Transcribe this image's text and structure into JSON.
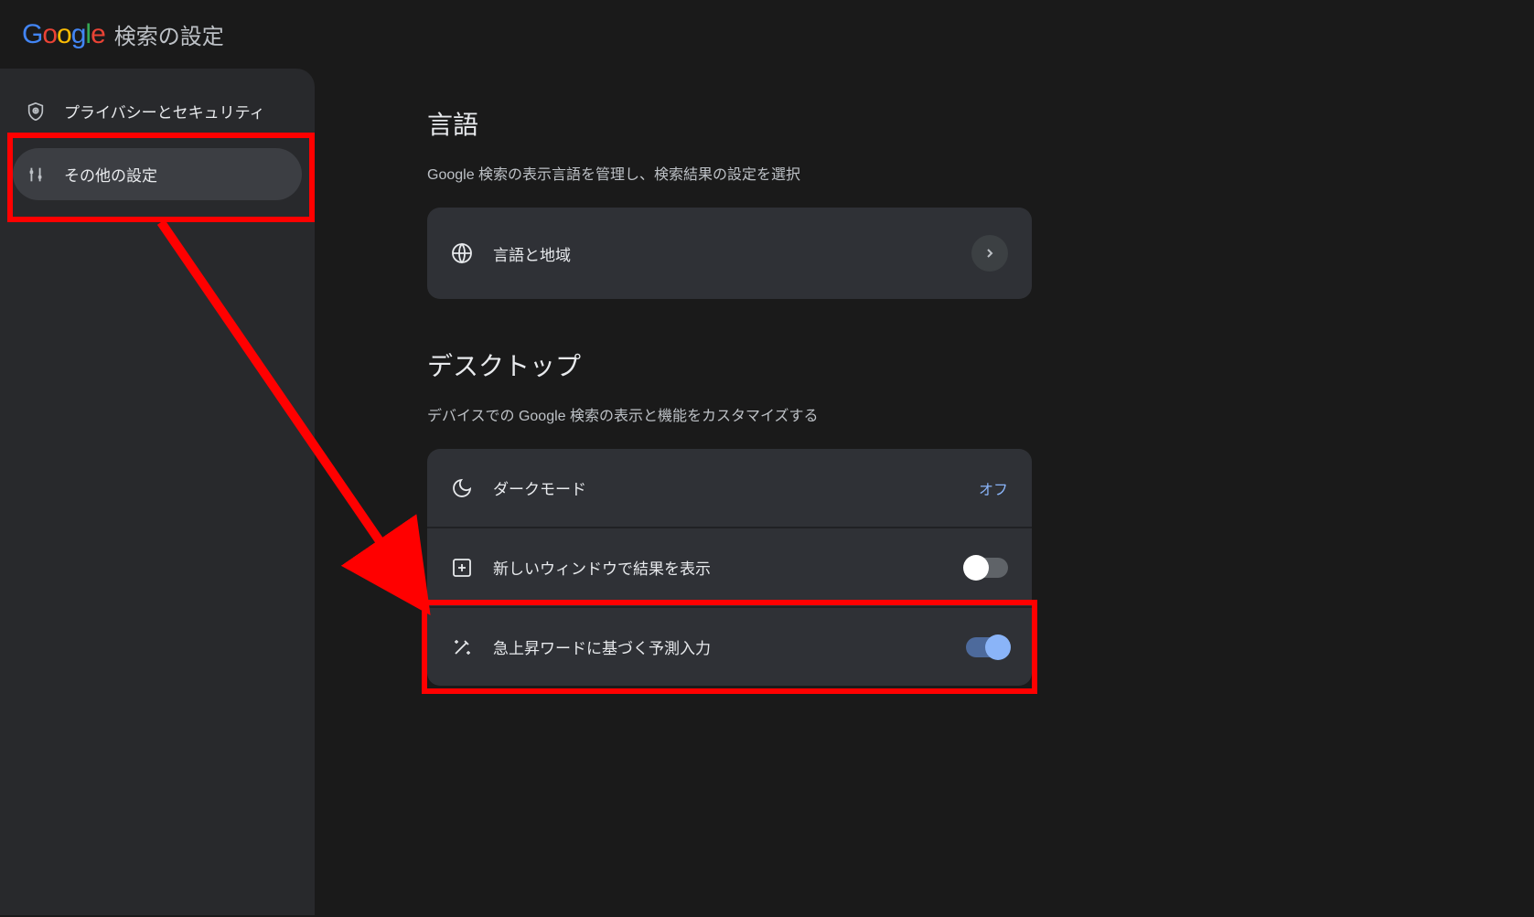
{
  "header": {
    "title": "検索の設定"
  },
  "sidebar": {
    "items": [
      {
        "label": "プライバシーとセキュリティ",
        "icon": "shield-icon",
        "selected": false
      },
      {
        "label": "その他の設定",
        "icon": "sliders-icon",
        "selected": true
      }
    ]
  },
  "sections": {
    "language": {
      "title": "言語",
      "desc": "Google 検索の表示言語を管理し、検索結果の設定を選択",
      "row_label": "言語と地域"
    },
    "desktop": {
      "title": "デスクトップ",
      "desc": "デバイスでの Google 検索の表示と機能をカスタマイズする",
      "rows": [
        {
          "label": "ダークモード",
          "value": "オフ",
          "type": "link"
        },
        {
          "label": "新しいウィンドウで結果を表示",
          "type": "toggle",
          "on": false
        },
        {
          "label": "急上昇ワードに基づく予測入力",
          "type": "toggle",
          "on": true
        }
      ]
    }
  }
}
